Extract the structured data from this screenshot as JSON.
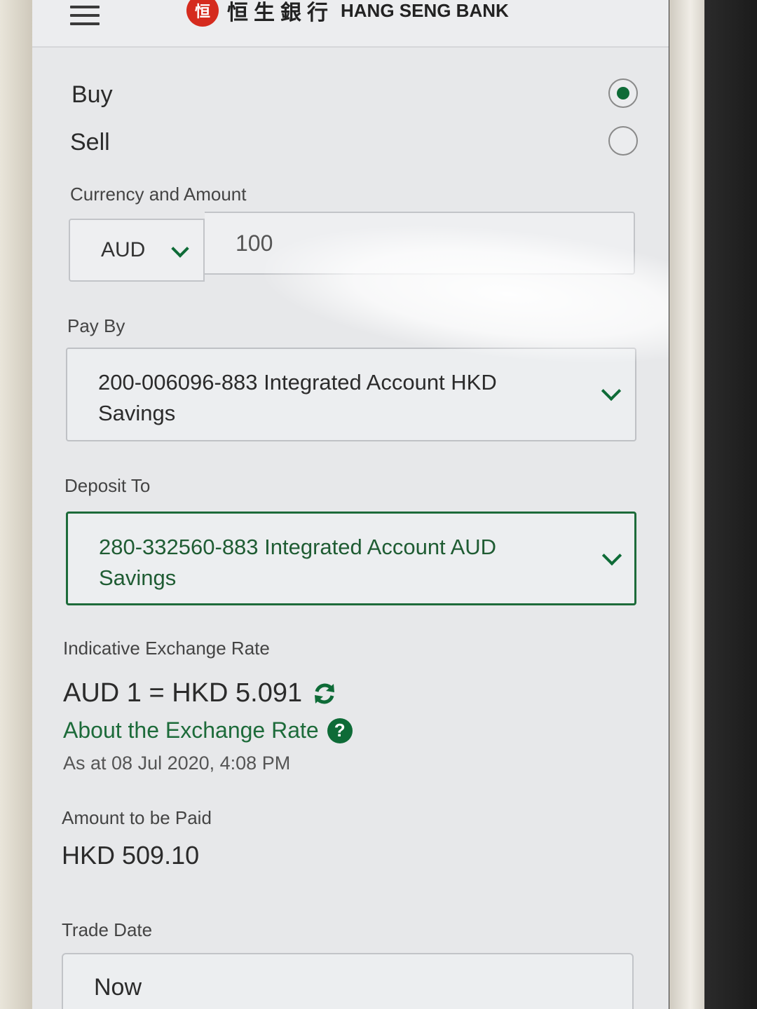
{
  "header": {
    "logo_mark": "恒",
    "logo_chinese": "恒生銀行",
    "logo_english": "HANG SENG BANK"
  },
  "transaction_type": {
    "options": [
      {
        "label": "Buy",
        "selected": true
      },
      {
        "label": "Sell",
        "selected": false
      }
    ]
  },
  "currency_amount": {
    "label": "Currency and Amount",
    "currency": "AUD",
    "amount": "100"
  },
  "pay_by": {
    "label": "Pay By",
    "account": "200-006096-883 Integrated Account HKD Savings"
  },
  "deposit_to": {
    "label": "Deposit To",
    "account": "280-332560-883 Integrated Account AUD Savings"
  },
  "exchange_rate": {
    "label": "Indicative Exchange Rate",
    "rate_text": "AUD 1 = HKD 5.091",
    "about_link": "About the Exchange Rate",
    "as_at": "As at 08 Jul 2020, 4:08 PM"
  },
  "amount_paid": {
    "label": "Amount to be Paid",
    "value": "HKD 509.10"
  },
  "trade_date": {
    "label": "Trade Date",
    "value": "Now"
  },
  "colors": {
    "brand_green": "#0e6b37",
    "brand_red": "#d52b1e"
  }
}
